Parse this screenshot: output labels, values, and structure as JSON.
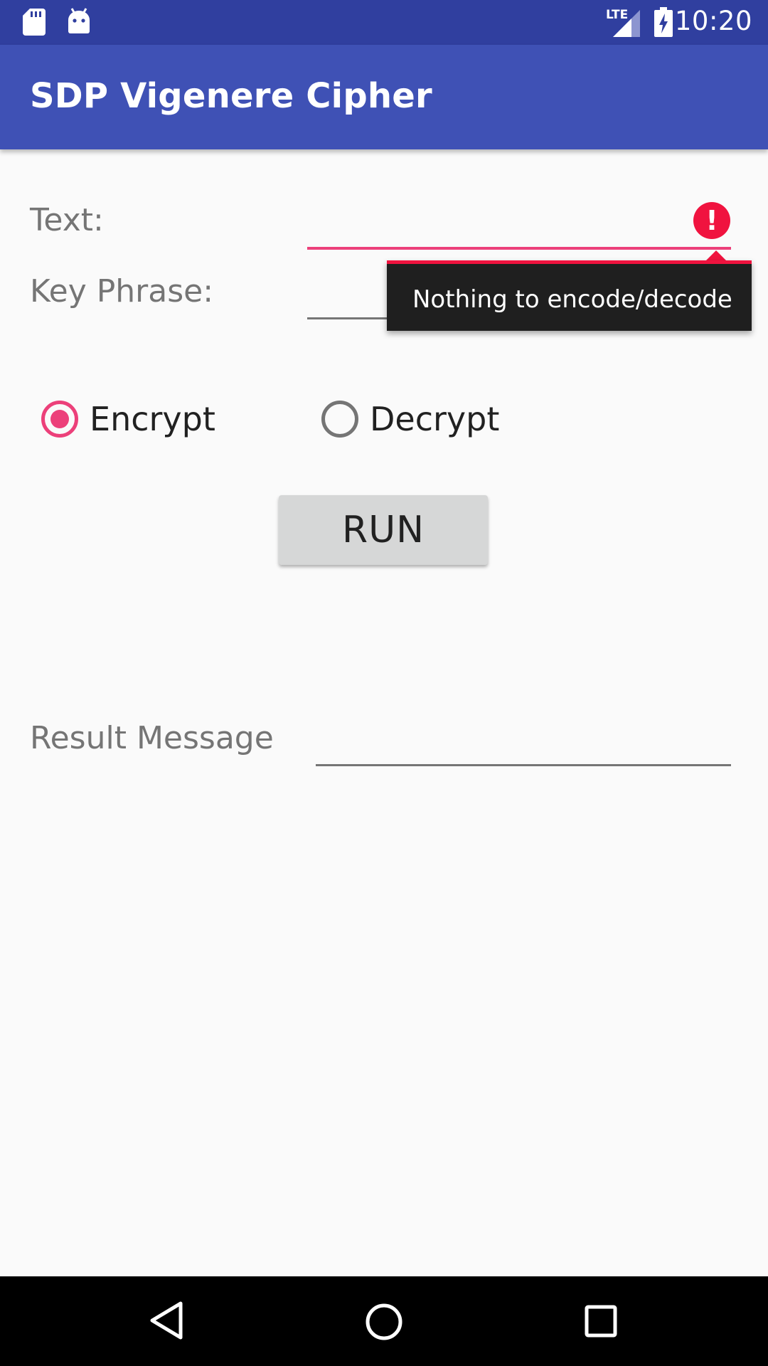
{
  "status_bar": {
    "time": "10:20",
    "network_label": "LTE",
    "icons": [
      "sd-card-icon",
      "android-icon",
      "signal-icon",
      "battery-charging-icon"
    ]
  },
  "app_bar": {
    "title": "SDP Vigenere Cipher"
  },
  "form": {
    "text_label": "Text:",
    "text_value": "",
    "key_label": "Key Phrase:",
    "key_value": "",
    "error_message": "Nothing to encode/decode"
  },
  "mode": {
    "options": [
      {
        "label": "Encrypt",
        "checked": true
      },
      {
        "label": "Decrypt",
        "checked": false
      }
    ]
  },
  "run_button": {
    "label": "RUN"
  },
  "result": {
    "label": "Result Message",
    "value": ""
  },
  "colors": {
    "primary": "#3f51b5",
    "primary_dark": "#303f9f",
    "accent": "#ec407a",
    "error": "#f0133f"
  },
  "nav_bar": {
    "icons": [
      "back-icon",
      "home-icon",
      "recents-icon"
    ]
  }
}
